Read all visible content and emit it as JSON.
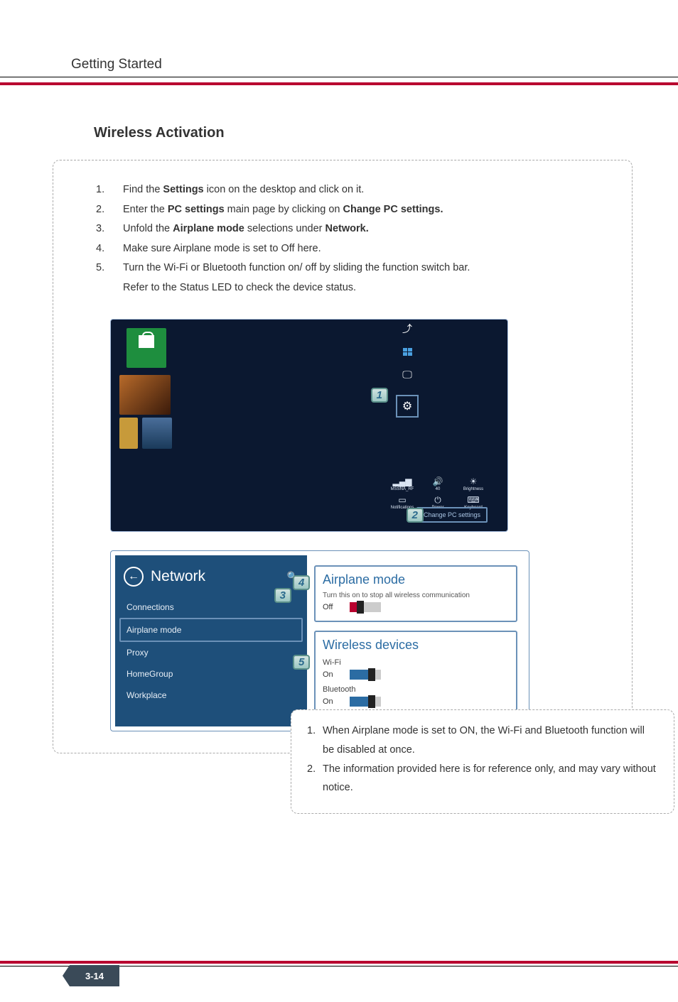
{
  "header": {
    "title": "Getting Started"
  },
  "section": {
    "title": "Wireless Activation"
  },
  "steps": [
    {
      "num": "1.",
      "pre": "Find the ",
      "b1": "Settings",
      "post1": " icon on the desktop and click on it."
    },
    {
      "num": "2.",
      "pre": "Enter the ",
      "b1": "PC settings",
      "mid": " main page by clicking on ",
      "b2": "Change PC settings."
    },
    {
      "num": "3.",
      "pre": "Unfold the ",
      "b1": "Airplane mode",
      "mid": " selections under ",
      "b2": "Network."
    },
    {
      "num": "4.",
      "text": "Make sure Airplane mode is set to Off here."
    },
    {
      "num": "5.",
      "text": "Turn the Wi-Fi or Bluetooth function on/ off by sliding the function switch bar.",
      "extra": "Refer to the Status LED to check the device status."
    }
  ],
  "screenshot1": {
    "charms": {
      "share": "Share",
      "start": "Start",
      "devices": "Devices",
      "settings": "Settings"
    },
    "quick": {
      "network": "MSSNA_RF",
      "sound": "40",
      "brightness": "Brightness",
      "notifications": "Notifications",
      "power": "Power",
      "keyboard": "Keyboard"
    },
    "change_link": "Change PC settings",
    "callouts": {
      "one": "1",
      "two": "2"
    }
  },
  "screenshot2": {
    "nav_title": "Network",
    "nav_items": [
      "Connections",
      "Airplane mode",
      "Proxy",
      "HomeGroup",
      "Workplace"
    ],
    "airplane": {
      "title": "Airplane mode",
      "sub": "Turn this on to stop all wireless communication",
      "state_label": "Off"
    },
    "wireless": {
      "title": "Wireless devices",
      "wifi_label": "Wi-Fi",
      "wifi_state": "On",
      "bt_label": "Bluetooth",
      "bt_state": "On"
    },
    "callouts": {
      "three": "3",
      "four": "4",
      "five": "5"
    }
  },
  "notes": [
    {
      "num": "1.",
      "text": "When Airplane mode is set to ON, the Wi-Fi and Bluetooth function will be disabled at once."
    },
    {
      "num": "2.",
      "text": "The information provided here is for reference only, and may vary without notice."
    }
  ],
  "page_number": "3-14"
}
